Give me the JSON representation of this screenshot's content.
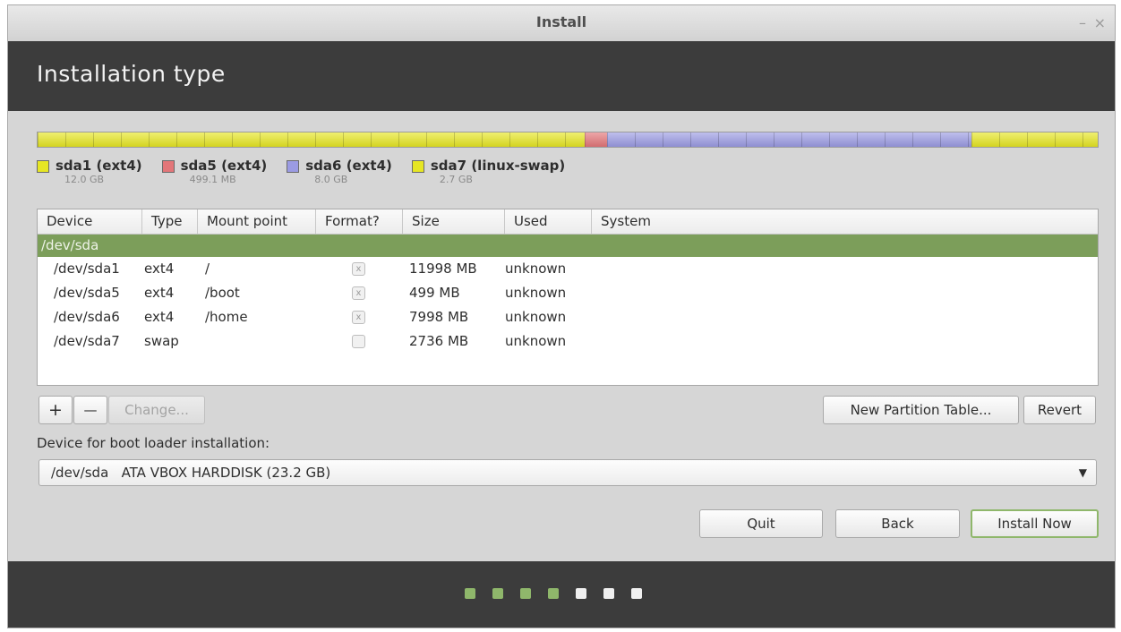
{
  "window": {
    "title": "Install",
    "minimize_glyph": "–",
    "close_glyph": "×"
  },
  "header": {
    "title": "Installation type"
  },
  "partition_bar": {
    "segments": [
      {
        "name": "sda1 (ext4)",
        "size": "12.0 GB",
        "color": "#e6e624",
        "fraction": 0.516
      },
      {
        "name": "sda5 (ext4)",
        "size": "499.1 MB",
        "color": "#e37679",
        "fraction": 0.021
      },
      {
        "name": "sda6 (ext4)",
        "size": "8.0 GB",
        "color": "#9b9be3",
        "fraction": 0.344
      },
      {
        "name": "sda7 (linux-swap)",
        "size": "2.7 GB",
        "color": "#e6e624",
        "fraction": 0.119
      }
    ]
  },
  "table": {
    "headers": [
      "Device",
      "Type",
      "Mount point",
      "Format?",
      "Size",
      "Used",
      "System"
    ],
    "group": "/dev/sda",
    "rows": [
      {
        "device": "/dev/sda1",
        "type": "ext4",
        "mount": "/",
        "format": "x",
        "size": "11998 MB",
        "used": "unknown",
        "system": ""
      },
      {
        "device": "/dev/sda5",
        "type": "ext4",
        "mount": "/boot",
        "format": "x",
        "size": "499 MB",
        "used": "unknown",
        "system": ""
      },
      {
        "device": "/dev/sda6",
        "type": "ext4",
        "mount": "/home",
        "format": "x",
        "size": "7998 MB",
        "used": "unknown",
        "system": ""
      },
      {
        "device": "/dev/sda7",
        "type": "swap",
        "mount": "",
        "format": "",
        "size": "2736 MB",
        "used": "unknown",
        "system": ""
      }
    ]
  },
  "toolbar": {
    "add": "+",
    "remove": "—",
    "change": "Change...",
    "new_table": "New Partition Table...",
    "revert": "Revert"
  },
  "bootloader": {
    "label": "Device for boot loader installation:",
    "value": "/dev/sda   ATA VBOX HARDDISK (23.2 GB)"
  },
  "actions": {
    "quit": "Quit",
    "back": "Back",
    "install": "Install Now"
  },
  "progress": {
    "completed_steps": 4,
    "total_steps": 7,
    "done_color": "#8fb76b",
    "todo_color": "#f0f0f0"
  }
}
